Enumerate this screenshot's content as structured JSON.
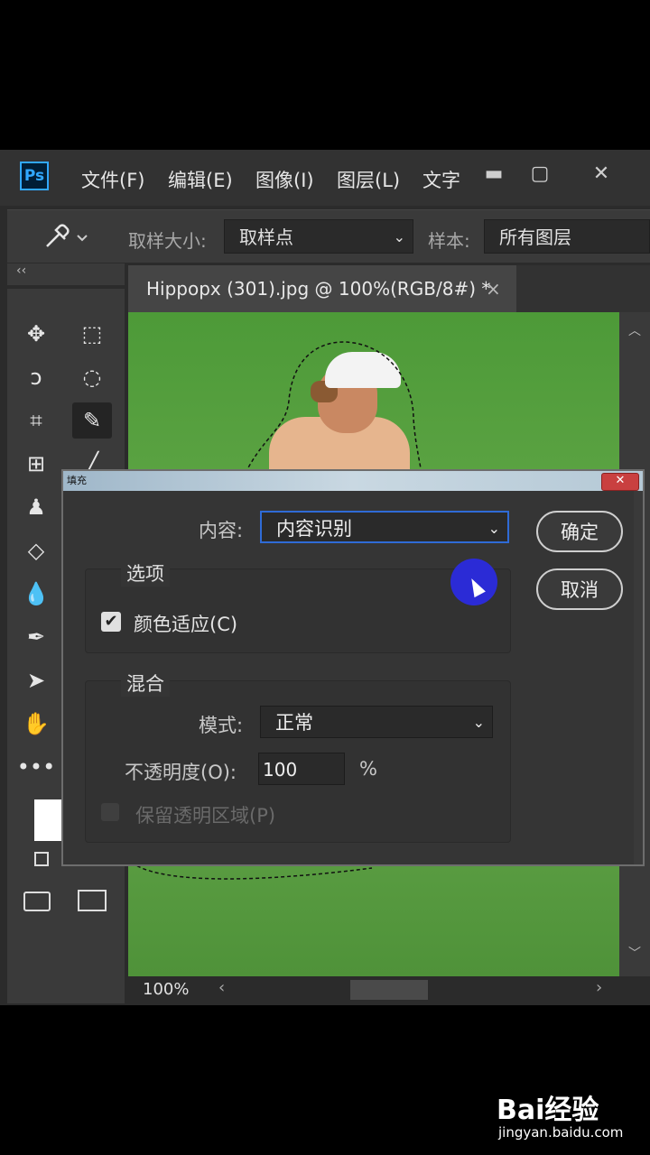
{
  "app": {
    "logo": "Ps"
  },
  "menu": [
    "文件(F)",
    "编辑(E)",
    "图像(I)",
    "图层(L)",
    "文字"
  ],
  "window_buttons": {
    "minimize": "▬",
    "restore": "▢",
    "close": "✕"
  },
  "options": {
    "sample_size_label": "取样大小:",
    "sample_size_value": "取样点",
    "sample_label": "样本:",
    "sample_value": "所有图层"
  },
  "panel_collapse": "‹‹",
  "tools": [
    "move-icon",
    "marquee-icon",
    "lasso-icon",
    "quick-select-icon",
    "crop-icon",
    "eyedropper-icon",
    "patch-icon",
    "brush-icon",
    "stamp-icon",
    "eraser-icon",
    "blur-icon",
    "pen-icon",
    "path-select-icon",
    "hand-icon",
    "more-icon"
  ],
  "document": {
    "tab_title": "Hippopx (301).jpg @ 100%(RGB/8#) *",
    "zoom": "100%"
  },
  "dialog": {
    "title": "填充",
    "content_label": "内容:",
    "content_value": "内容识别",
    "options_title": "选项",
    "color_adapt_label": "颜色适应(C)",
    "color_adapt_checked": true,
    "blend_title": "混合",
    "mode_label": "模式:",
    "mode_value": "正常",
    "opacity_label": "不透明度(O):",
    "opacity_value": "100",
    "opacity_unit": "%",
    "preserve_label": "保留透明区域(P)",
    "ok": "确定",
    "cancel": "取消"
  },
  "watermark": {
    "brand": "Bai经验",
    "url": "jingyan.baidu.com"
  }
}
